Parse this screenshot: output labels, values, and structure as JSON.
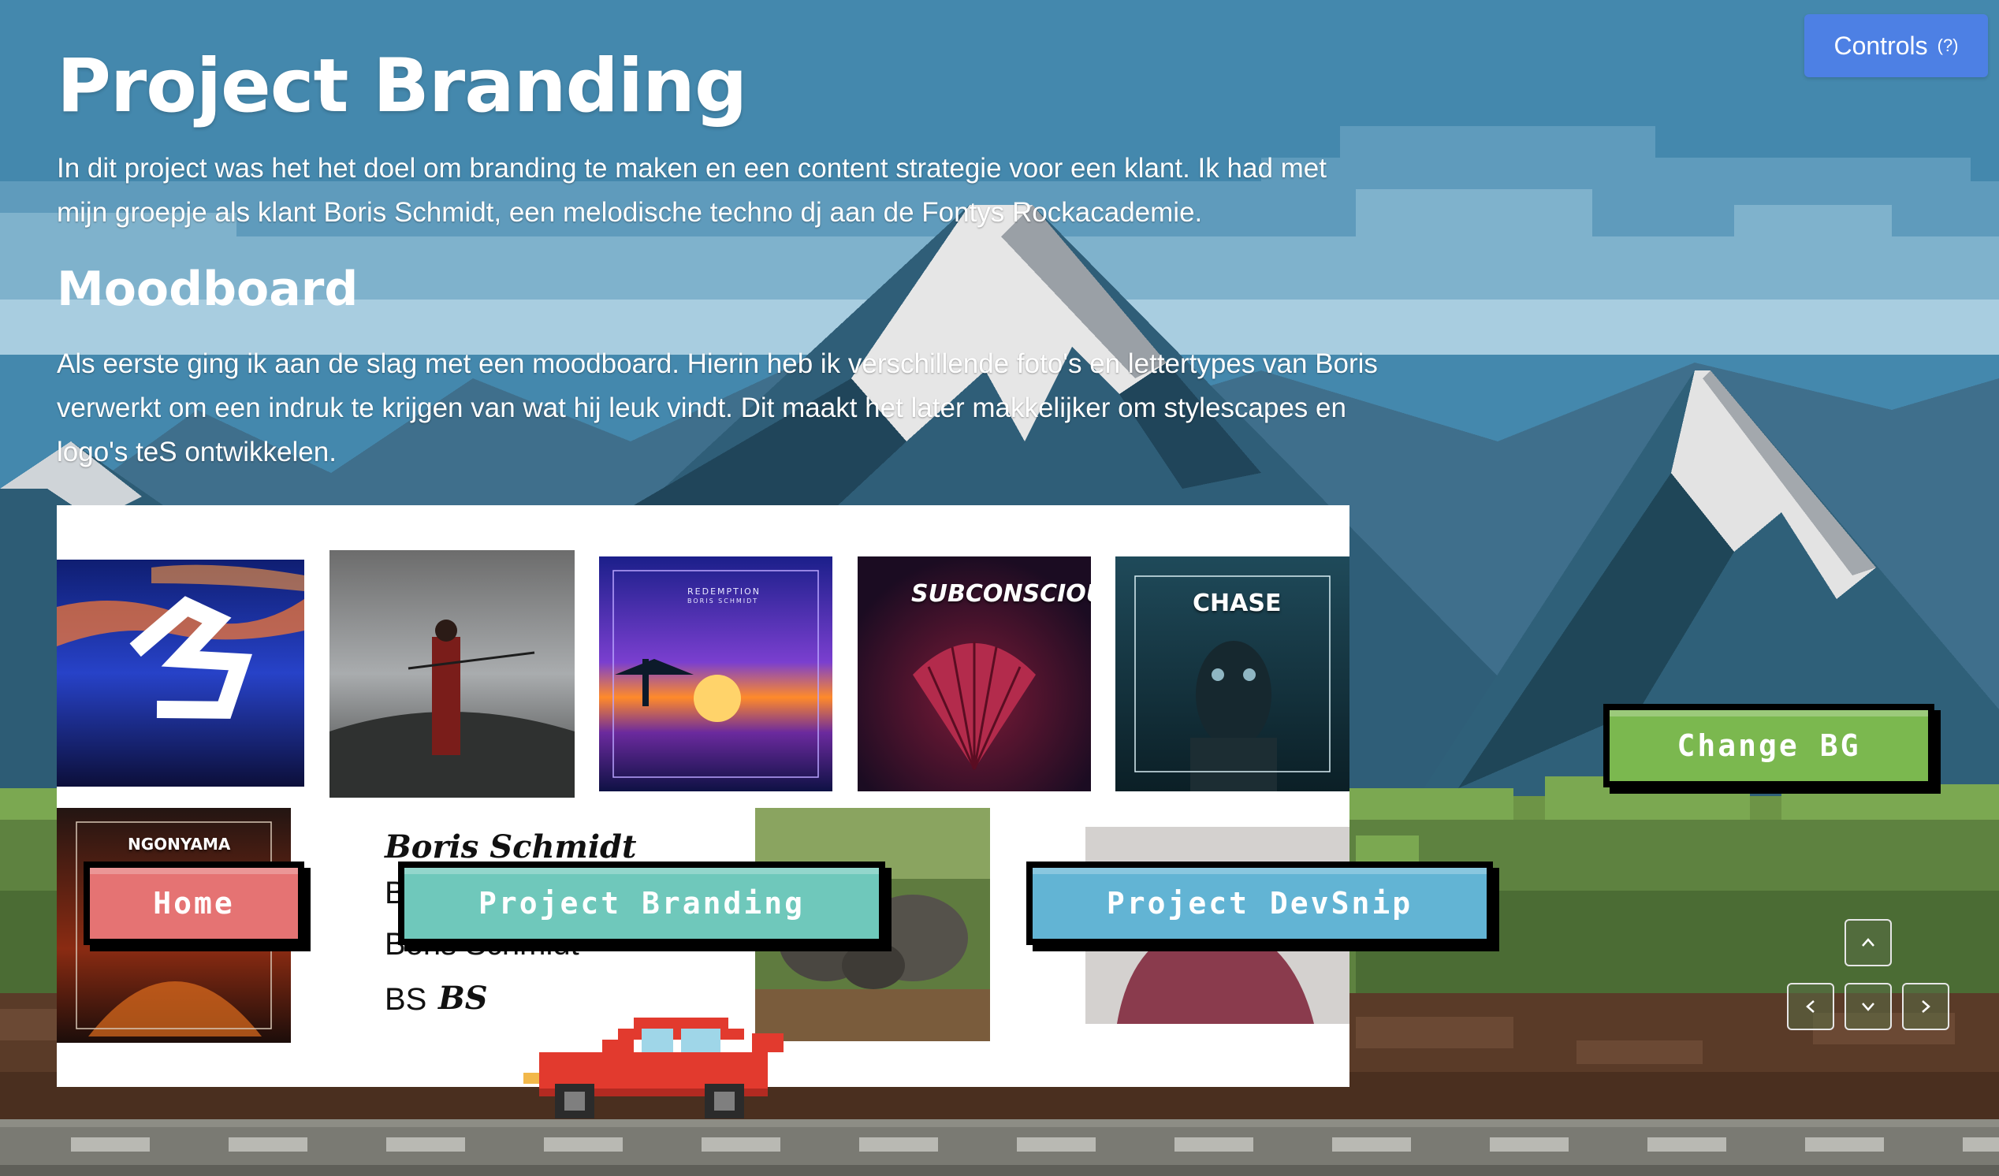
{
  "header": {
    "title": "Project Branding",
    "intro": "In dit project was het het doel om branding te maken en een content strategie voor een klant. Ik had met mijn groepje als klant Boris Schmidt, een melodische techno dj aan de Fontys Rockacademie."
  },
  "moodboard_section": {
    "heading": "Moodboard",
    "text": "Als eerste ging ik aan de slag met een moodboard. Hierin heb ik verschillende foto's en lettertypes van Boris verwerkt om een indruk te krijgen van wat hij leuk vindt. Dit maakt het later makkelijker om stylescapes en logo's teS ontwikkelen."
  },
  "moodboard": {
    "tiles": {
      "redemption_title": "REDEMPTION",
      "redemption_artist": "BORIS SCHMIDT",
      "subconscious": "SUBCONSCIOUS",
      "chase": "CHASE",
      "ngonyama": "NGONYAMA"
    },
    "fonts": {
      "sample1": "Boris Schmidt",
      "sample2": "B",
      "sample3": "Boris Schmidt",
      "sample4": "BS",
      "logo": "BS"
    }
  },
  "controls": {
    "label": "Controls",
    "help": "(?)"
  },
  "nav": {
    "home": "Home",
    "branding": "Project Branding",
    "devsnip": "Project DevSnip",
    "change_bg": "Change BG"
  },
  "colors": {
    "sky": "#4488ad",
    "controls": "#4d80e4",
    "home": "#e57373",
    "branding": "#6fc8bb",
    "devsnip": "#62b4d4",
    "change_bg": "#7bb84f"
  }
}
